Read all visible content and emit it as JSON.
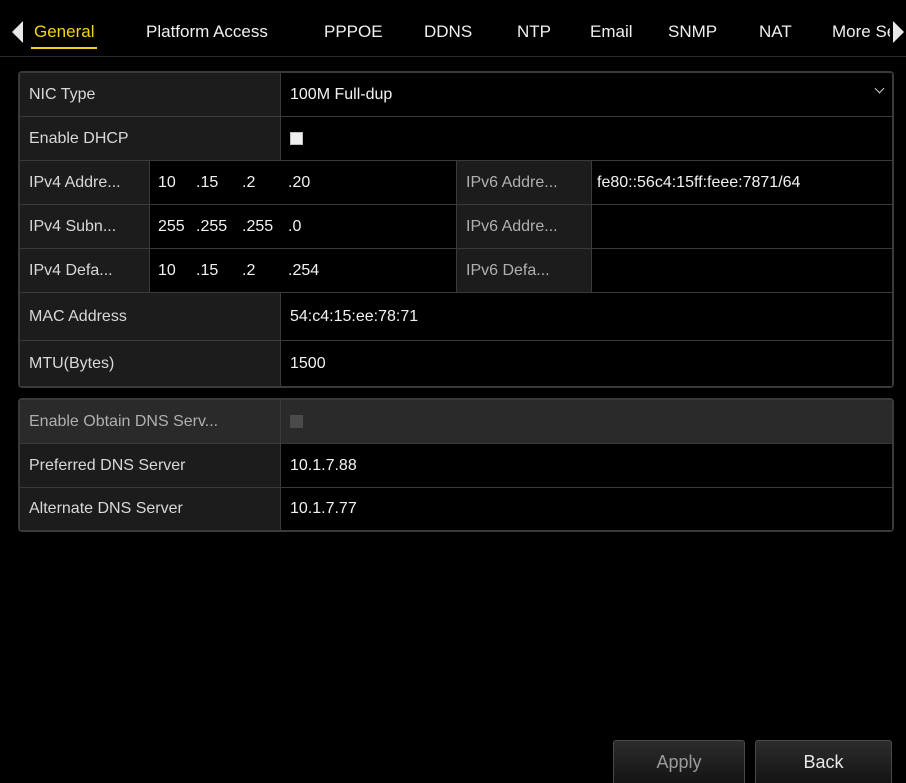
{
  "tabs": [
    {
      "label": "General",
      "active": true
    },
    {
      "label": "Platform Access"
    },
    {
      "label": "PPPOE"
    },
    {
      "label": "DDNS"
    },
    {
      "label": "NTP"
    },
    {
      "label": "Email"
    },
    {
      "label": "SNMP"
    },
    {
      "label": "NAT"
    },
    {
      "label": "More Settings"
    }
  ],
  "form": {
    "nic_type": {
      "label": "NIC Type",
      "value": "100M Full-dup"
    },
    "enable_dhcp": {
      "label": "Enable DHCP",
      "checked": false
    },
    "ipv4_address": {
      "label": "IPv4 Addre...",
      "parts": [
        "10",
        ".15",
        ".2",
        ".20"
      ]
    },
    "ipv4_subnet": {
      "label": "IPv4 Subn...",
      "parts": [
        "255",
        ".255",
        ".255",
        ".0"
      ]
    },
    "ipv4_gateway": {
      "label": "IPv4 Defa...",
      "parts": [
        "10",
        ".15",
        ".2",
        ".254"
      ]
    },
    "ipv6_address1": {
      "label": "IPv6 Addre...",
      "value": "fe80::56c4:15ff:feee:7871/64"
    },
    "ipv6_address2": {
      "label": "IPv6 Addre...",
      "value": ""
    },
    "ipv6_gateway": {
      "label": "IPv6 Defa...",
      "value": ""
    },
    "mac_address": {
      "label": "MAC Address",
      "value": "54:c4:15:ee:78:71"
    },
    "mtu": {
      "label": "MTU(Bytes)",
      "value": "1500"
    }
  },
  "dns": {
    "auto_dns": {
      "label": "Enable Obtain DNS Serv...",
      "checked": false,
      "disabled": true
    },
    "preferred": {
      "label": "Preferred DNS Server",
      "value": "10.1.7.88"
    },
    "alternate": {
      "label": "Alternate DNS Server",
      "value": "10.1.7.77"
    }
  },
  "buttons": {
    "apply": "Apply",
    "back": "Back"
  },
  "colors": {
    "active_tab": "#f4d21a",
    "label_bg": "#1c1c1c",
    "background": "#000000"
  }
}
